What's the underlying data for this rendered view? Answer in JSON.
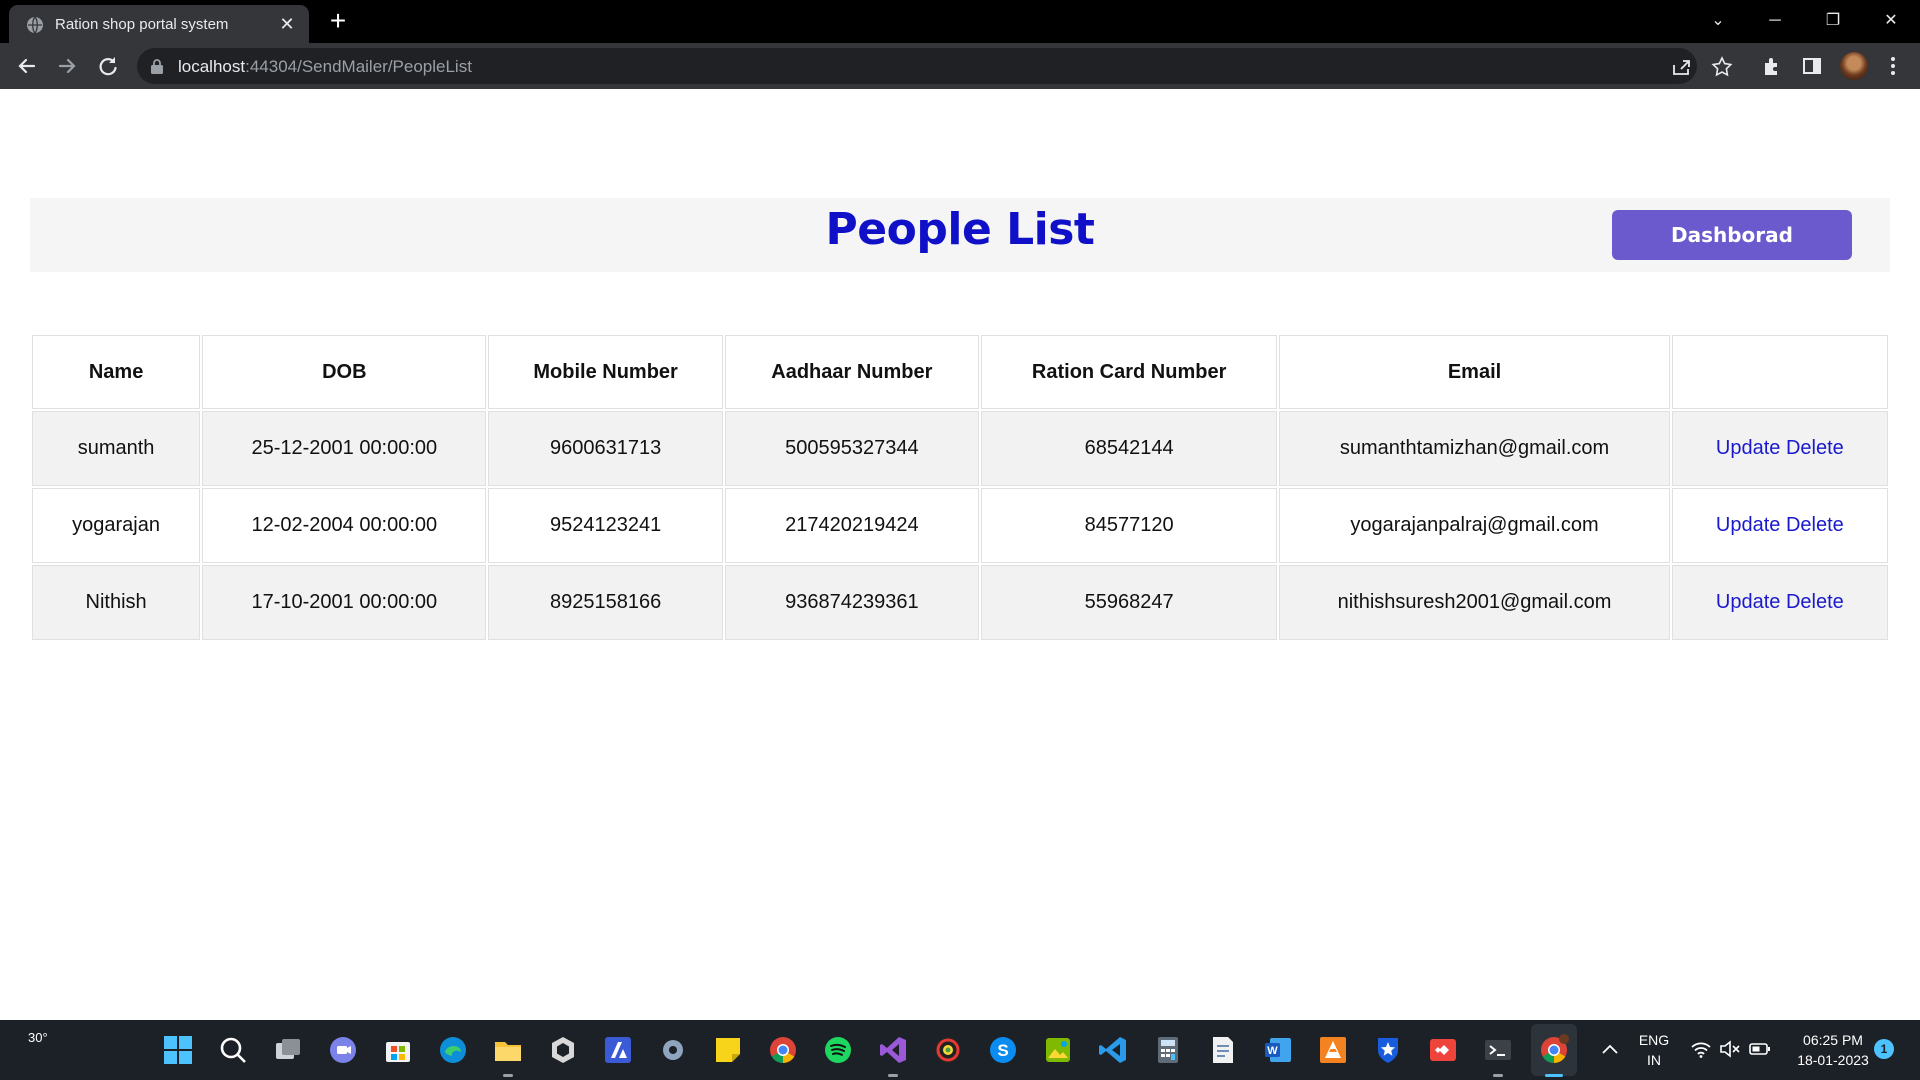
{
  "browser": {
    "tab_title": "Ration shop portal system",
    "url_host": "localhost",
    "url_path": ":44304/SendMailer/PeopleList"
  },
  "page": {
    "title": "People List",
    "dashboard_button": "Dashborad"
  },
  "table": {
    "headers": [
      "Name",
      "DOB",
      "Mobile Number",
      "Aadhaar Number",
      "Ration Card Number",
      "Email",
      ""
    ],
    "rows": [
      {
        "name": "sumanth",
        "dob": "25-12-2001 00:00:00",
        "mobile": "9600631713",
        "aadhaar": "500595327344",
        "ration_card": "68542144",
        "email": "sumanthtamizhan@gmail.com",
        "update": "Update",
        "delete": "Delete"
      },
      {
        "name": "yogarajan",
        "dob": "12-02-2004 00:00:00",
        "mobile": "9524123241",
        "aadhaar": "217420219424",
        "ration_card": "84577120",
        "email": "yogarajanpalraj@gmail.com",
        "update": "Update",
        "delete": "Delete"
      },
      {
        "name": "Nithish",
        "dob": "17-10-2001 00:00:00",
        "mobile": "8925158166",
        "aadhaar": "936874239361",
        "ration_card": "55968247",
        "email": "nithishsuresh2001@gmail.com",
        "update": "Update",
        "delete": "Delete"
      }
    ]
  },
  "taskbar": {
    "weather": "30°",
    "lang_line1": "ENG",
    "lang_line2": "IN",
    "time": "06:25 PM",
    "date": "18-01-2023",
    "notification_count": "1",
    "apps": [
      "start-icon",
      "search-icon",
      "task-view-icon",
      "teams-icon",
      "store-icon",
      "edge-icon",
      "file-explorer-icon",
      "unity-icon",
      "azure-icon",
      "settings-icon",
      "sticky-notes-icon",
      "chrome-icon",
      "spotify-icon",
      "visual-studio-icon",
      "chrome-variant-icon",
      "skype-icon",
      "photos-icon",
      "vscode-icon",
      "calculator-icon",
      "notepad-icon",
      "word-icon",
      "vlc-icon",
      "bitwarden-icon",
      "anydesk-icon",
      "terminal-icon",
      "chrome-active-icon"
    ]
  },
  "colors": {
    "title": "#1010c8",
    "button": "#6a5acd",
    "link": "#1a1acc",
    "row_shade": "#f2f2f2"
  }
}
